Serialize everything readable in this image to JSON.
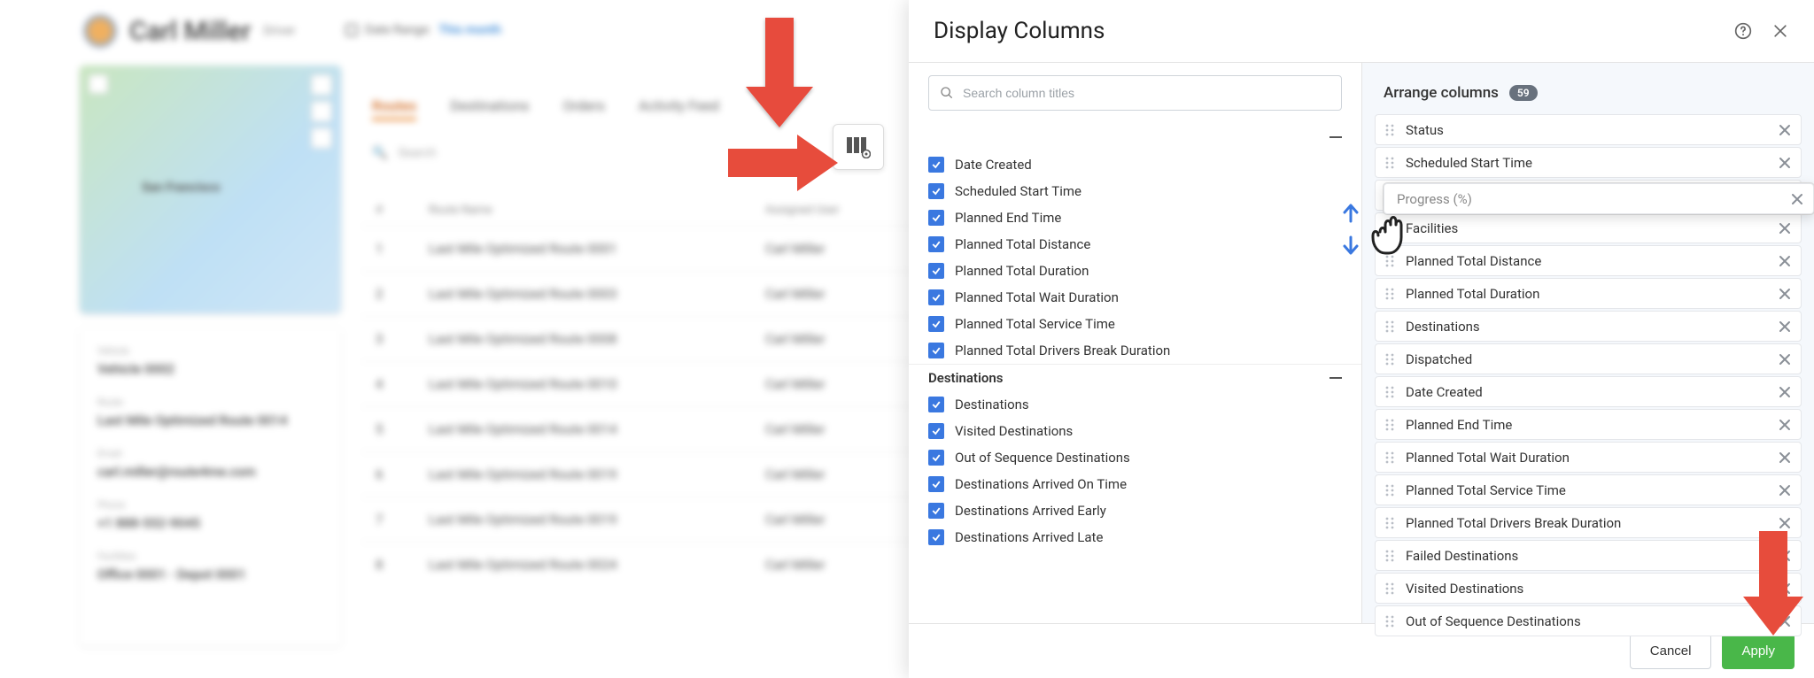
{
  "header": {
    "user_name": "Carl Miller",
    "role": "Driver",
    "date_range_label": "Date Range:",
    "date_range_value": "This month"
  },
  "map_city": "San Francisco",
  "card": {
    "vehicle_label": "Vehicle",
    "vehicle_value": "Vehicle 0002",
    "route_label": "Route",
    "route_value": "Last Mile Optimized Route 0014",
    "email_label": "Email",
    "email_value": "carl.miller@route4me.com",
    "phone_label": "Phone",
    "phone_value": "+1 888-552-9045",
    "facilities_label": "Facilities",
    "facilities_value": "Office 0001 - Depot 0001"
  },
  "tabs": [
    "Routes",
    "Destinations",
    "Orders",
    "Activity Feed"
  ],
  "table": {
    "h1": "#",
    "h2": "Route Name",
    "h3": "Assigned User",
    "rows": [
      {
        "n": "1",
        "name": "Last Mile Optimized Route 0001",
        "user": "Carl Miller"
      },
      {
        "n": "2",
        "name": "Last Mile Optimized Route 0003",
        "user": "Carl Miller"
      },
      {
        "n": "3",
        "name": "Last Mile Optimized Route 0008",
        "user": "Carl Miller"
      },
      {
        "n": "4",
        "name": "Last Mile Optimized Route 0010",
        "user": "Carl Miller"
      },
      {
        "n": "5",
        "name": "Last Mile Optimized Route 0014",
        "user": "Carl Miller"
      },
      {
        "n": "6",
        "name": "Last Mile Optimized Route 0019",
        "user": "Carl Miller"
      },
      {
        "n": "7",
        "name": "Last Mile Optimized Route 0019",
        "user": "Carl Miller"
      },
      {
        "n": "8",
        "name": "Last Mile Optimized Route 0024",
        "user": "Carl Miller"
      }
    ]
  },
  "drawer": {
    "title": "Display Columns",
    "search_placeholder": "Search column titles",
    "group1_items": [
      "Date Created",
      "Scheduled Start Time",
      "Planned End Time",
      "Planned Total Distance",
      "Planned Total Duration",
      "Planned Total Wait Duration",
      "Planned Total Service Time",
      "Planned Total Drivers Break Duration"
    ],
    "group2_title": "Destinations",
    "group2_items": [
      "Destinations",
      "Visited Destinations",
      "Out of Sequence Destinations",
      "Destinations Arrived On Time",
      "Destinations Arrived Early",
      "Destinations Arrived Late"
    ],
    "arrange_title": "Arrange columns",
    "arrange_count": "59",
    "arranged": [
      "Status",
      "Scheduled Start Time",
      "Progress (%)",
      "Facilities",
      "Planned Total Distance",
      "Planned Total Duration",
      "Destinations",
      "Dispatched",
      "Date Created",
      "Planned End Time",
      "Planned Total Wait Duration",
      "Planned Total Service Time",
      "Planned Total Drivers Break Duration",
      "Failed Destinations",
      "Visited Destinations",
      "Out of Sequence Destinations"
    ],
    "dragging_label": "Progress (%)",
    "cancel": "Cancel",
    "apply": "Apply"
  },
  "annotation_colors": {
    "arrow": "#e74c3c",
    "apply_highlight": "#e74c3c"
  }
}
